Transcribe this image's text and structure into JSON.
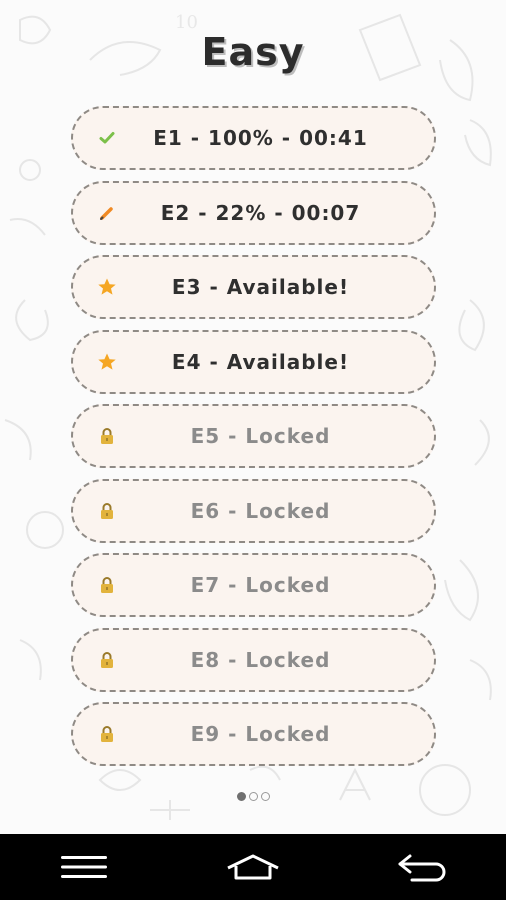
{
  "screen": {
    "title": "Easy"
  },
  "levels": [
    {
      "label": "E1 - 100% - 00:41",
      "status": "completed",
      "icon": "checkmark-icon"
    },
    {
      "label": "E2 - 22% - 00:07",
      "status": "in-progress",
      "icon": "pencil-icon"
    },
    {
      "label": "E3 - Available!",
      "status": "available",
      "icon": "star-icon"
    },
    {
      "label": "E4 - Available!",
      "status": "available",
      "icon": "star-icon"
    },
    {
      "label": "E5 - Locked",
      "status": "locked",
      "icon": "lock-icon"
    },
    {
      "label": "E6 - Locked",
      "status": "locked",
      "icon": "lock-icon"
    },
    {
      "label": "E7 - Locked",
      "status": "locked",
      "icon": "lock-icon"
    },
    {
      "label": "E8 - Locked",
      "status": "locked",
      "icon": "lock-icon"
    },
    {
      "label": "E9 - Locked",
      "status": "locked",
      "icon": "lock-icon"
    }
  ],
  "pager": {
    "page_count": 3,
    "current_page": 1
  },
  "navbar": {
    "buttons": [
      "menu-icon",
      "home-icon",
      "back-icon"
    ]
  },
  "colors": {
    "item_background": "#fbf4ef",
    "item_border": "#8f8a85",
    "text_dark": "#2f2f2f",
    "text_locked": "#8b8b8b",
    "check_green": "#7cc04a",
    "star_orange": "#f5a623",
    "lock_gold": "#e2b33c"
  }
}
